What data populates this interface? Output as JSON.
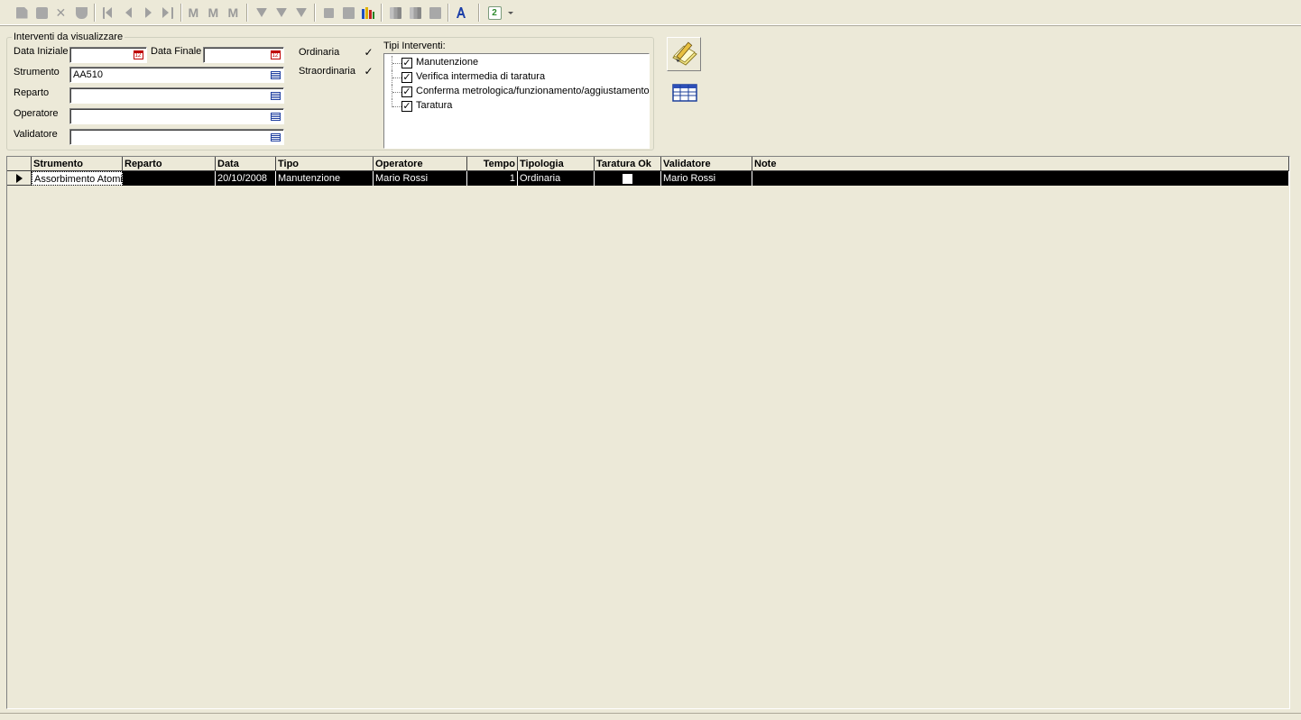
{
  "toolbar": {
    "buttons": [
      {
        "name": "new-record",
        "icon": "new-document-icon",
        "enabled": false
      },
      {
        "name": "save",
        "icon": "floppy-disk-icon",
        "enabled": false
      },
      {
        "name": "delete",
        "icon": "delete-x-icon",
        "enabled": false
      },
      {
        "name": "undo",
        "icon": "undo-icon",
        "enabled": false
      },
      {
        "name": "first",
        "icon": "first-record-icon",
        "enabled": false
      },
      {
        "name": "previous",
        "icon": "previous-record-icon",
        "enabled": false
      },
      {
        "name": "next",
        "icon": "next-record-icon",
        "enabled": false
      },
      {
        "name": "last",
        "icon": "last-record-icon",
        "enabled": false
      },
      {
        "name": "find",
        "icon": "binoculars-icon",
        "enabled": false
      },
      {
        "name": "find-next",
        "icon": "binoculars-next-icon",
        "enabled": false
      },
      {
        "name": "find-previous",
        "icon": "binoculars-previous-icon",
        "enabled": false
      },
      {
        "name": "filter-by-selection",
        "icon": "filter-selection-icon",
        "enabled": false
      },
      {
        "name": "filter",
        "icon": "filter-icon",
        "enabled": false
      },
      {
        "name": "remove-filter",
        "icon": "remove-filter-icon",
        "enabled": false
      },
      {
        "name": "form",
        "icon": "form-icon",
        "enabled": false
      },
      {
        "name": "print",
        "icon": "printer-icon",
        "enabled": false
      },
      {
        "name": "report",
        "icon": "report-chart-icon",
        "enabled": true
      },
      {
        "name": "copy",
        "icon": "copy-icon",
        "enabled": false
      },
      {
        "name": "paste",
        "icon": "paste-icon",
        "enabled": false
      },
      {
        "name": "clipboard",
        "icon": "clipboard-icon",
        "enabled": false
      },
      {
        "name": "spell-check",
        "icon": "spell-check-icon",
        "enabled": true
      },
      {
        "name": "refresh",
        "icon": "refresh-icon",
        "enabled": true
      }
    ]
  },
  "filters": {
    "group_title": "Interventi da visualizzare",
    "data_iniziale_label": "Data Iniziale",
    "data_iniziale_value": "",
    "data_finale_label": "Data Finale",
    "data_finale_value": "",
    "strumento_label": "Strumento",
    "strumento_value": "AA510",
    "reparto_label": "Reparto",
    "reparto_value": "",
    "operatore_label": "Operatore",
    "operatore_value": "",
    "validatore_label": "Validatore",
    "validatore_value": "",
    "ordinaria_label": "Ordinaria",
    "ordinaria_checked": "✓",
    "straordinaria_label": "Straordinaria",
    "straordinaria_checked": "✓"
  },
  "tipi_interventi": {
    "title": "Tipi Interventi:",
    "items": [
      {
        "label": "Manutenzione",
        "checked": "✓"
      },
      {
        "label": "Verifica intermedia di taratura",
        "checked": "✓"
      },
      {
        "label": "Conferma metrologica/funzionamento/aggiustamento",
        "checked": "✓"
      },
      {
        "label": "Taratura",
        "checked": "✓"
      }
    ]
  },
  "actions": {
    "edit_icon": "pencil-paper-icon",
    "grid_icon": "table-grid-icon"
  },
  "grid": {
    "columns": [
      "Strumento",
      "Reparto",
      "Data",
      "Tipo",
      "Operatore",
      "Tempo",
      "Tipologia",
      "Taratura Ok",
      "Validatore",
      "Note"
    ],
    "rows": [
      {
        "strumento": "Assorbimento Atomico",
        "reparto": "",
        "data": "20/10/2008",
        "tipo": "Manutenzione",
        "operatore": "Mario Rossi",
        "tempo": "1",
        "tipologia": "Ordinaria",
        "taratura_ok": false,
        "validatore": "Mario Rossi",
        "note": ""
      }
    ],
    "selected_row_color": "#000000"
  }
}
